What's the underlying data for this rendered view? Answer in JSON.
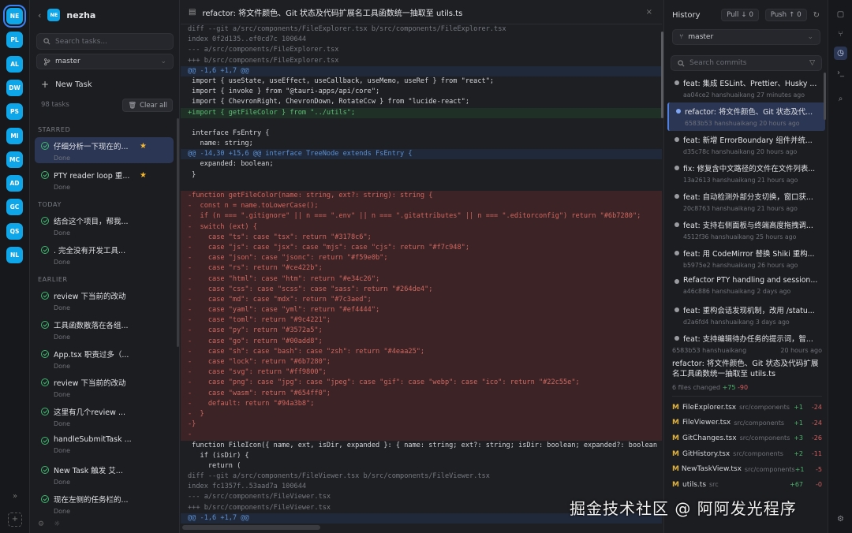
{
  "workspaces": [
    {
      "label": "NE",
      "color": "#0ea5e9",
      "active": true
    },
    {
      "label": "PL",
      "color": "#0ea5e9"
    },
    {
      "label": "AL",
      "color": "#0ea5e9"
    },
    {
      "label": "DW",
      "color": "#0ea5e9"
    },
    {
      "label": "PS",
      "color": "#0ea5e9"
    },
    {
      "label": "MI",
      "color": "#0ea5e9"
    },
    {
      "label": "MC",
      "color": "#0ea5e9"
    },
    {
      "label": "AD",
      "color": "#0ea5e9"
    },
    {
      "label": "GC",
      "color": "#0ea5e9"
    },
    {
      "label": "QS",
      "color": "#0ea5e9"
    },
    {
      "label": "NL",
      "color": "#0ea5e9"
    }
  ],
  "sidebar": {
    "project_badge": "NE",
    "project_name": "nezha",
    "search_placeholder": "Search tasks...",
    "branch": "master",
    "new_task": "New Task",
    "count": "98 tasks",
    "clear_all": "Clear all",
    "sections": {
      "starred": "STARRED",
      "today": "TODAY",
      "earlier": "EARLIER"
    },
    "starred": [
      {
        "title": "仔细分析一下现在的...",
        "status": "Done"
      },
      {
        "title": "PTY reader loop 重...",
        "status": "Done"
      }
    ],
    "today": [
      {
        "title": "结合这个项目，帮我...",
        "status": "Done"
      },
      {
        "title": ". 完全没有开发工具...",
        "status": "Done"
      }
    ],
    "earlier": [
      {
        "title": "review 下当前的改动",
        "status": "Done"
      },
      {
        "title": "工具函数散落在各组...",
        "status": "Done"
      },
      {
        "title": "App.tsx 职责过多（...",
        "status": "Done"
      },
      {
        "title": "review 下当前的改动",
        "status": "Done"
      },
      {
        "title": "这里有几个review ...",
        "status": "Done"
      },
      {
        "title": "handleSubmitTask ...",
        "status": "Done"
      },
      {
        "title": "New Task 触发 艾...",
        "status": "Done"
      },
      {
        "title": "现在左侧的任务栏的...",
        "status": "Done"
      }
    ]
  },
  "editor": {
    "title": "refactor: 将文件颜色、Git 状态及代码扩展名工具函数统一抽取至 utils.ts",
    "lines": [
      {
        "k": "meta",
        "t": "diff --git a/src/components/FileExplorer.tsx b/src/components/FileExplorer.tsx"
      },
      {
        "k": "meta",
        "t": "index 0f2d135..ef0cd7c 100644"
      },
      {
        "k": "meta",
        "t": "--- a/src/components/FileExplorer.tsx"
      },
      {
        "k": "meta",
        "t": "+++ b/src/components/FileExplorer.tsx"
      },
      {
        "k": "hunk",
        "t": "@@ -1,6 +1,7 @@"
      },
      {
        "k": "ctx",
        "t": " import { useState, useEffect, useCallback, useMemo, useRef } from \"react\";"
      },
      {
        "k": "ctx",
        "t": " import { invoke } from \"@tauri-apps/api/core\";"
      },
      {
        "k": "ctx",
        "t": " import { ChevronRight, ChevronDown, RotateCcw } from \"lucide-react\";"
      },
      {
        "k": "add",
        "t": "+import { getFileColor } from \"../utils\";"
      },
      {
        "k": "ctx",
        "t": " "
      },
      {
        "k": "ctx",
        "t": " interface FsEntry {"
      },
      {
        "k": "ctx",
        "t": "   name: string;"
      },
      {
        "k": "hunk",
        "t": "@@ -14,30 +15,6 @@ interface TreeNode extends FsEntry {"
      },
      {
        "k": "ctx",
        "t": "   expanded: boolean;"
      },
      {
        "k": "ctx",
        "t": " }"
      },
      {
        "k": "ctx",
        "t": " "
      },
      {
        "k": "del",
        "t": "-function getFileColor(name: string, ext?: string): string {"
      },
      {
        "k": "del",
        "t": "-  const n = name.toLowerCase();"
      },
      {
        "k": "del",
        "t": "-  if (n === \".gitignore\" || n === \".env\" || n === \".gitattributes\" || n === \".editorconfig\") return \"#6b7280\";"
      },
      {
        "k": "del",
        "t": "-  switch (ext) {"
      },
      {
        "k": "del",
        "t": "-    case \"ts\": case \"tsx\": return \"#3178c6\";"
      },
      {
        "k": "del",
        "t": "-    case \"js\": case \"jsx\": case \"mjs\": case \"cjs\": return \"#f7c948\";"
      },
      {
        "k": "del",
        "t": "-    case \"json\": case \"jsonc\": return \"#f59e0b\";"
      },
      {
        "k": "del",
        "t": "-    case \"rs\": return \"#ce422b\";"
      },
      {
        "k": "del",
        "t": "-    case \"html\": case \"htm\": return \"#e34c26\";"
      },
      {
        "k": "del",
        "t": "-    case \"css\": case \"scss\": case \"sass\": return \"#264de4\";"
      },
      {
        "k": "del",
        "t": "-    case \"md\": case \"mdx\": return \"#7c3aed\";"
      },
      {
        "k": "del",
        "t": "-    case \"yaml\": case \"yml\": return \"#ef4444\";"
      },
      {
        "k": "del",
        "t": "-    case \"toml\": return \"#9c4221\";"
      },
      {
        "k": "del",
        "t": "-    case \"py\": return \"#3572a5\";"
      },
      {
        "k": "del",
        "t": "-    case \"go\": return \"#00add8\";"
      },
      {
        "k": "del",
        "t": "-    case \"sh\": case \"bash\": case \"zsh\": return \"#4eaa25\";"
      },
      {
        "k": "del",
        "t": "-    case \"lock\": return \"#6b7280\";"
      },
      {
        "k": "del",
        "t": "-    case \"svg\": return \"#ff9800\";"
      },
      {
        "k": "del",
        "t": "-    case \"png\": case \"jpg\": case \"jpeg\": case \"gif\": case \"webp\": case \"ico\": return \"#22c55e\";"
      },
      {
        "k": "del",
        "t": "-    case \"wasm\": return \"#654ff0\";"
      },
      {
        "k": "del",
        "t": "-    default: return \"#94a3b8\";"
      },
      {
        "k": "del",
        "t": "-  }"
      },
      {
        "k": "del",
        "t": "-}"
      },
      {
        "k": "del",
        "t": "-"
      },
      {
        "k": "ctx",
        "t": " function FileIcon({ name, ext, isDir, expanded }: { name: string; ext?: string; isDir: boolean; expanded?: boolean }) {"
      },
      {
        "k": "ctx",
        "t": "   if (isDir) {"
      },
      {
        "k": "ctx",
        "t": "     return ("
      },
      {
        "k": "meta",
        "t": "diff --git a/src/components/FileViewer.tsx b/src/components/FileViewer.tsx"
      },
      {
        "k": "meta",
        "t": "index fc1357f..53aad7a 100644"
      },
      {
        "k": "meta",
        "t": "--- a/src/components/FileViewer.tsx"
      },
      {
        "k": "meta",
        "t": "+++ b/src/components/FileViewer.tsx"
      },
      {
        "k": "hunk",
        "t": "@@ -1,6 +1,7 @@"
      }
    ]
  },
  "history": {
    "title": "History",
    "pull_label": "Pull",
    "pull_count": "0",
    "push_label": "Push",
    "push_count": "0",
    "branch": "master",
    "search_placeholder": "Search commits",
    "commits": [
      {
        "msg": "feat: 集成 ESLint、Prettier、Husky ...",
        "sub": "aa04ce2  hanshuaikang  27 minutes ago"
      },
      {
        "msg": "refactor: 将文件颜色、Git 状态及代...",
        "sub": "6583b53  hanshuaikang  20 hours ago",
        "selected": true
      },
      {
        "msg": "feat: 新增 ErrorBoundary 组件并统...",
        "sub": "d35c78c  hanshuaikang  20 hours ago"
      },
      {
        "msg": "fix: 修复含中文路径的文件在文件列表...",
        "sub": "13a2613  hanshuaikang  21 hours ago"
      },
      {
        "msg": "feat: 自动检测外部分支切换，窗口获...",
        "sub": "20c8763  hanshuaikang  21 hours ago"
      },
      {
        "msg": "feat: 支持右侧面板与终端高度拖拽调...",
        "sub": "4512f36  hanshuaikang  25 hours ago"
      },
      {
        "msg": "feat: 用 CodeMirror 替换 Shiki 重构...",
        "sub": "b5975e2  hanshuaikang  26 hours ago"
      },
      {
        "msg": "Refactor PTY handling and session...",
        "sub": "a46c886  hanshuaikang  2 days ago"
      },
      {
        "msg": "feat: 重构会话发现机制，改用 /statu...",
        "sub": "d2a6fd4  hanshuaikang  3 days ago"
      },
      {
        "msg": "feat: 支持编辑待办任务的提示词，智...",
        "sub": ""
      }
    ],
    "detail": {
      "hash": "6583b53  hanshuaikang",
      "time": "20 hours ago",
      "message": "refactor: 将文件颜色、Git 状态及代码扩展名工具函数统一抽取至 utils.ts",
      "changed": "6 files changed",
      "added": "+75",
      "removed": "-90"
    },
    "files": [
      {
        "status": "M",
        "name": "FileExplorer.tsx",
        "path": "src/components",
        "add": "+1",
        "del": "-24"
      },
      {
        "status": "M",
        "name": "FileViewer.tsx",
        "path": "src/components",
        "add": "+1",
        "del": "-24"
      },
      {
        "status": "M",
        "name": "GitChanges.tsx",
        "path": "src/components",
        "add": "+3",
        "del": "-26"
      },
      {
        "status": "M",
        "name": "GitHistory.tsx",
        "path": "src/components",
        "add": "+2",
        "del": "-11"
      },
      {
        "status": "M",
        "name": "NewTaskView.tsx",
        "path": "src/components",
        "add": "+1",
        "del": "-5"
      },
      {
        "status": "M",
        "name": "utils.ts",
        "path": "src",
        "add": "+67",
        "del": "-0"
      }
    ]
  },
  "watermark": "掘金技术社区 @ 阿阿发光程序"
}
